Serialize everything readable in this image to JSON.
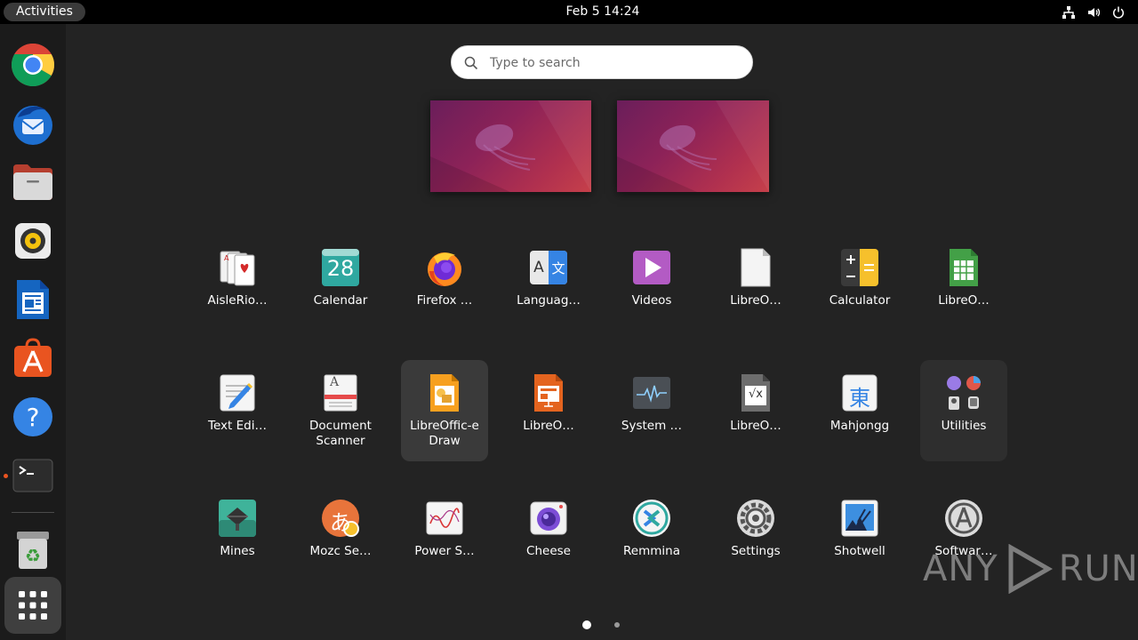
{
  "topbar": {
    "activities": "Activities",
    "clock": "Feb 5  14:24",
    "tray_icons": [
      "network-icon",
      "volume-icon",
      "power-icon"
    ]
  },
  "dock": {
    "items": [
      {
        "name": "Google Chrome",
        "icon": "chrome-icon"
      },
      {
        "name": "Thunderbird Mail",
        "icon": "thunderbird-icon"
      },
      {
        "name": "Files",
        "icon": "files-icon"
      },
      {
        "name": "Rhythmbox",
        "icon": "rhythmbox-icon"
      },
      {
        "name": "LibreOffice Writer",
        "icon": "writer-icon"
      },
      {
        "name": "Ubuntu Software",
        "icon": "software-icon"
      },
      {
        "name": "Help",
        "icon": "help-icon"
      },
      {
        "name": "Terminal",
        "icon": "terminal-icon",
        "running": true
      },
      {
        "name": "Trash",
        "icon": "trash-icon"
      }
    ],
    "show_apps": "apps-grid-icon"
  },
  "search": {
    "placeholder": "Type to search"
  },
  "apps": [
    {
      "label": "AisleRio…"
    },
    {
      "label": "Calendar",
      "icon_text": "28"
    },
    {
      "label": "Firefox …"
    },
    {
      "label": "Languag…",
      "icon_text_a": "A",
      "icon_text_b": "文"
    },
    {
      "label": "Videos"
    },
    {
      "label": "LibreO…"
    },
    {
      "label": "Calculator"
    },
    {
      "label": "LibreO…"
    },
    {
      "label": "Text Edi…"
    },
    {
      "label": "Document Scanner",
      "icon_text": "A"
    },
    {
      "label": "LibreOffic-e Draw"
    },
    {
      "label": "LibreO…"
    },
    {
      "label": "System …"
    },
    {
      "label": "LibreO…",
      "icon_text": "√x"
    },
    {
      "label": "Mahjongg",
      "icon_text": "東"
    },
    {
      "label": "Utilities"
    },
    {
      "label": "Mines"
    },
    {
      "label": "Mozc Se…",
      "icon_text": "あ"
    },
    {
      "label": "Power S…"
    },
    {
      "label": "Cheese"
    },
    {
      "label": "Remmina"
    },
    {
      "label": "Settings"
    },
    {
      "label": "Shotwell"
    },
    {
      "label": "Softwar…"
    }
  ],
  "pagination": {
    "current": 1,
    "total": 2
  },
  "watermark": {
    "text_left": "ANY",
    "text_right": "RUN"
  }
}
